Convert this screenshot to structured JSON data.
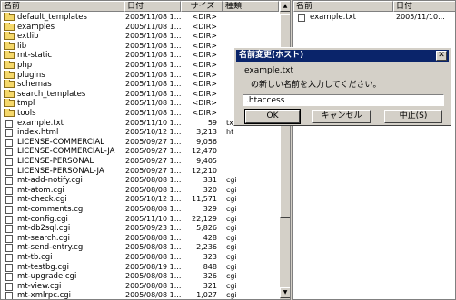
{
  "left_pane": {
    "columns": {
      "name": "名前",
      "date": "日付",
      "size": "サイズ",
      "type": "種類"
    },
    "rows": [
      {
        "icon": "folder-icon",
        "name": "default_templates",
        "date": "2005/11/08 1...",
        "size": "<DIR>",
        "type": ""
      },
      {
        "icon": "folder-icon",
        "name": "examples",
        "date": "2005/11/08 1...",
        "size": "<DIR>",
        "type": ""
      },
      {
        "icon": "folder-icon",
        "name": "extlib",
        "date": "2005/11/08 1...",
        "size": "<DIR>",
        "type": ""
      },
      {
        "icon": "folder-icon",
        "name": "lib",
        "date": "2005/11/08 1...",
        "size": "<DIR>",
        "type": ""
      },
      {
        "icon": "folder-icon",
        "name": "mt-static",
        "date": "2005/11/08 1...",
        "size": "<DIR>",
        "type": ""
      },
      {
        "icon": "folder-icon",
        "name": "php",
        "date": "2005/11/08 1...",
        "size": "<DIR>",
        "type": ""
      },
      {
        "icon": "folder-icon",
        "name": "plugins",
        "date": "2005/11/08 1...",
        "size": "<DIR>",
        "type": ""
      },
      {
        "icon": "folder-icon",
        "name": "schemas",
        "date": "2005/11/08 1...",
        "size": "<DIR>",
        "type": ""
      },
      {
        "icon": "folder-icon",
        "name": "search_templates",
        "date": "2005/11/08 1...",
        "size": "<DIR>",
        "type": ""
      },
      {
        "icon": "folder-icon",
        "name": "tmpl",
        "date": "2005/11/08 1...",
        "size": "<DIR>",
        "type": ""
      },
      {
        "icon": "folder-icon",
        "name": "tools",
        "date": "2005/11/08 1...",
        "size": "<DIR>",
        "type": ""
      },
      {
        "icon": "file-icon",
        "name": "example.txt",
        "date": "2005/11/10 1...",
        "size": "59",
        "type": "tx"
      },
      {
        "icon": "file-icon",
        "name": "index.html",
        "date": "2005/10/12 1...",
        "size": "3,213",
        "type": "ht"
      },
      {
        "icon": "file-icon",
        "name": "LICENSE-COMMERCIAL",
        "date": "2005/09/27 1...",
        "size": "9,056",
        "type": ""
      },
      {
        "icon": "file-icon",
        "name": "LICENSE-COMMERCIAL-JA",
        "date": "2005/09/27 1...",
        "size": "12,470",
        "type": ""
      },
      {
        "icon": "file-icon",
        "name": "LICENSE-PERSONAL",
        "date": "2005/09/27 1...",
        "size": "9,405",
        "type": ""
      },
      {
        "icon": "file-icon",
        "name": "LICENSE-PERSONAL-JA",
        "date": "2005/09/27 1...",
        "size": "12,210",
        "type": ""
      },
      {
        "icon": "file-icon",
        "name": "mt-add-notify.cgi",
        "date": "2005/08/08 1...",
        "size": "331",
        "type": "cgi"
      },
      {
        "icon": "file-icon",
        "name": "mt-atom.cgi",
        "date": "2005/08/08 1...",
        "size": "320",
        "type": "cgi"
      },
      {
        "icon": "file-icon",
        "name": "mt-check.cgi",
        "date": "2005/10/12 1...",
        "size": "11,571",
        "type": "cgi"
      },
      {
        "icon": "file-icon",
        "name": "mt-comments.cgi",
        "date": "2005/08/08 1...",
        "size": "329",
        "type": "cgi"
      },
      {
        "icon": "file-icon",
        "name": "mt-config.cgi",
        "date": "2005/11/10 1...",
        "size": "22,129",
        "type": "cgi"
      },
      {
        "icon": "file-icon",
        "name": "mt-db2sql.cgi",
        "date": "2005/09/23 1...",
        "size": "5,826",
        "type": "cgi"
      },
      {
        "icon": "file-icon",
        "name": "mt-search.cgi",
        "date": "2005/08/08 1...",
        "size": "428",
        "type": "cgi"
      },
      {
        "icon": "file-icon",
        "name": "mt-send-entry.cgi",
        "date": "2005/08/08 1...",
        "size": "2,236",
        "type": "cgi"
      },
      {
        "icon": "file-icon",
        "name": "mt-tb.cgi",
        "date": "2005/08/08 1...",
        "size": "323",
        "type": "cgi"
      },
      {
        "icon": "file-icon",
        "name": "mt-testbg.cgi",
        "date": "2005/08/19 1...",
        "size": "848",
        "type": "cgi"
      },
      {
        "icon": "file-icon",
        "name": "mt-upgrade.cgi",
        "date": "2005/08/08 1...",
        "size": "326",
        "type": "cgi"
      },
      {
        "icon": "file-icon",
        "name": "mt-view.cgi",
        "date": "2005/08/08 1...",
        "size": "321",
        "type": "cgi"
      },
      {
        "icon": "file-icon",
        "name": "mt-xmlrpc.cgi",
        "date": "2005/08/08 1...",
        "size": "1,027",
        "type": "cgi"
      },
      {
        "icon": "file-icon",
        "name": "mt.cgi",
        "date": "2005/08/08 1...",
        "size": "315",
        "type": "cgi"
      }
    ]
  },
  "right_pane": {
    "columns": {
      "name": "名前",
      "date": "日付"
    },
    "rows": [
      {
        "icon": "file-icon",
        "name": "example.txt",
        "date": "2005/11/10..."
      }
    ]
  },
  "dialog": {
    "title": "名前変更(ホスト)",
    "filename": "example.txt",
    "prompt": "の新しい名前を入力してください。",
    "input_value": ".htaccess",
    "ok_label": "OK",
    "cancel_label": "キャンセル",
    "abort_label": "中止(S)",
    "close_glyph": "✕"
  },
  "colors": {
    "title_bar": "#0a246a",
    "face": "#d4d0c8",
    "folder": "#f5d86a"
  }
}
